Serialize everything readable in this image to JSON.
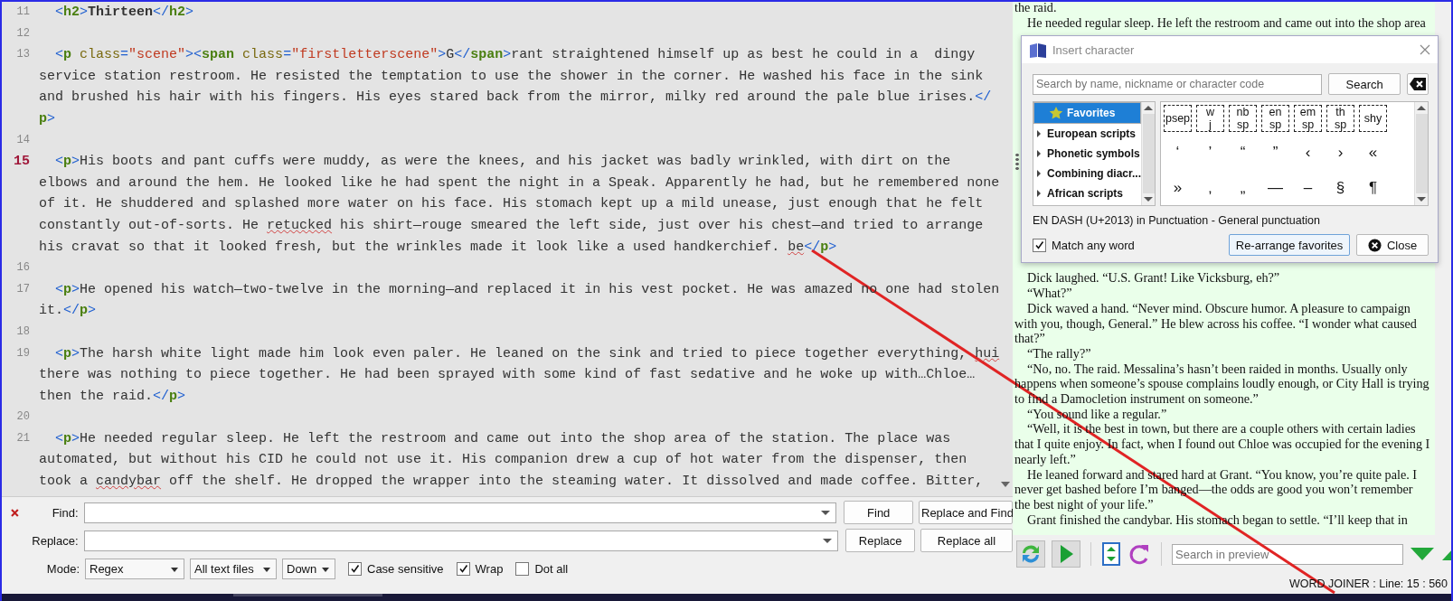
{
  "editor": {
    "lines": [
      {
        "number": "11",
        "current": false,
        "rows": [
          {
            "segments": [
              {
                "kind": "punct",
                "text": "<"
              },
              {
                "kind": "tag",
                "text": "h2"
              },
              {
                "kind": "punct",
                "text": ">"
              },
              {
                "kind": "bold",
                "text": "Thirteen"
              },
              {
                "kind": "punct",
                "text": "</"
              },
              {
                "kind": "tag",
                "text": "h2"
              },
              {
                "kind": "punct",
                "text": ">"
              }
            ]
          }
        ]
      },
      {
        "number": "12",
        "current": false
      },
      {
        "number": "13",
        "current": false,
        "rows": [
          {
            "segments": [
              {
                "kind": "punct",
                "text": "<"
              },
              {
                "kind": "tag",
                "text": "p"
              },
              {
                "kind": "attr",
                "text": " class"
              },
              {
                "kind": "punct",
                "text": "="
              },
              {
                "kind": "value",
                "text": "\"scene\""
              },
              {
                "kind": "punct",
                "text": "><"
              },
              {
                "kind": "tag",
                "text": "span"
              },
              {
                "kind": "attr",
                "text": " class"
              },
              {
                "kind": "punct",
                "text": "="
              },
              {
                "kind": "value",
                "text": "\"firstletterscene\""
              },
              {
                "kind": "punct",
                "text": ">"
              },
              {
                "kind": "text",
                "text": "G"
              },
              {
                "kind": "punct",
                "text": "</"
              },
              {
                "kind": "tag",
                "text": "span"
              },
              {
                "kind": "punct",
                "text": ">"
              },
              {
                "kind": "text",
                "text": "rant straightened himself up as best he could in a  dingy"
              }
            ]
          },
          {
            "segments": [
              {
                "kind": "text",
                "text": "service station restroom. He resisted the temptation to use the shower in the corner. He washed his face in the sink"
              }
            ]
          },
          {
            "segments": [
              {
                "kind": "text",
                "text": "and brushed his hair with his fingers. His eyes stared back from the mirror, milky red around the pale blue irises."
              },
              {
                "kind": "punct",
                "text": "</"
              }
            ]
          },
          {
            "segments": [
              {
                "kind": "tag",
                "text": "p"
              },
              {
                "kind": "punct",
                "text": ">"
              }
            ]
          }
        ]
      },
      {
        "number": "14",
        "current": false
      },
      {
        "number": "15",
        "current": true,
        "rows": [
          {
            "segments": [
              {
                "kind": "punct",
                "text": "<"
              },
              {
                "kind": "tag",
                "text": "p"
              },
              {
                "kind": "punct",
                "text": ">"
              },
              {
                "kind": "text",
                "text": "His boots and pant cuffs were muddy, as were the knees, and his jacket was badly wrinkled, with dirt on the"
              }
            ]
          },
          {
            "segments": [
              {
                "kind": "text",
                "text": "elbows and around the hem. He looked like he had spent the night in a Speak. Apparently he had, but he remembered none"
              }
            ]
          },
          {
            "segments": [
              {
                "kind": "text",
                "text": "of it. He shuddered and splashed more water on his face. His stomach kept up a mild unease, just enough that he felt"
              }
            ]
          },
          {
            "segments": [
              {
                "kind": "text",
                "text": "constantly out-of-sorts. He "
              },
              {
                "kind": "misspelled",
                "text": "retucked"
              },
              {
                "kind": "text",
                "text": " his shirt—rouge smeared the left side, just over his chest—and tried to arrange"
              }
            ]
          },
          {
            "segments": [
              {
                "kind": "text",
                "text": "his cravat so that it looked fresh, but the wrinkles made it look like a used handkerchief. "
              },
              {
                "kind": "misspelled",
                "text": "be"
              },
              {
                "kind": "punct",
                "text": "</"
              },
              {
                "kind": "tag",
                "text": "p"
              },
              {
                "kind": "punct",
                "text": ">"
              }
            ]
          }
        ]
      },
      {
        "number": "16",
        "current": false
      },
      {
        "number": "17",
        "current": false,
        "rows": [
          {
            "segments": [
              {
                "kind": "punct",
                "text": "<"
              },
              {
                "kind": "tag",
                "text": "p"
              },
              {
                "kind": "punct",
                "text": ">"
              },
              {
                "kind": "text",
                "text": "He opened his watch—two-twelve in the morning—and replaced it in his vest pocket. He was amazed no one had stolen"
              }
            ]
          },
          {
            "segments": [
              {
                "kind": "text",
                "text": "it."
              },
              {
                "kind": "punct",
                "text": "</"
              },
              {
                "kind": "tag",
                "text": "p"
              },
              {
                "kind": "punct",
                "text": ">"
              }
            ]
          }
        ]
      },
      {
        "number": "18",
        "current": false
      },
      {
        "number": "19",
        "current": false,
        "rows": [
          {
            "segments": [
              {
                "kind": "punct",
                "text": "<"
              },
              {
                "kind": "tag",
                "text": "p"
              },
              {
                "kind": "punct",
                "text": ">"
              },
              {
                "kind": "text",
                "text": "The harsh white light made him look even paler. He leaned on the sink and tried to piece together everything, "
              },
              {
                "kind": "misspelled",
                "text": "hui"
              }
            ]
          },
          {
            "segments": [
              {
                "kind": "text",
                "text": "there was nothing to piece together. He had been sprayed with some kind of fast sedative and he woke up with…Chloe…"
              }
            ]
          },
          {
            "segments": [
              {
                "kind": "text",
                "text": "then the raid."
              },
              {
                "kind": "punct",
                "text": "</"
              },
              {
                "kind": "tag",
                "text": "p"
              },
              {
                "kind": "punct",
                "text": ">"
              }
            ]
          }
        ]
      },
      {
        "number": "20",
        "current": false
      },
      {
        "number": "21",
        "current": false,
        "rows": [
          {
            "segments": [
              {
                "kind": "punct",
                "text": "<"
              },
              {
                "kind": "tag",
                "text": "p"
              },
              {
                "kind": "punct",
                "text": ">"
              },
              {
                "kind": "text",
                "text": "He needed regular sleep. He left the restroom and came out into the shop area of the station. The place was"
              }
            ]
          },
          {
            "segments": [
              {
                "kind": "text",
                "text": "automated, but without his CID he could not use it. His companion drew a cup of hot water from the dispenser, then"
              }
            ]
          },
          {
            "segments": [
              {
                "kind": "text",
                "text": "took a "
              },
              {
                "kind": "misspelled",
                "text": "candybar"
              },
              {
                "kind": "text",
                "text": " off the shelf. He dropped the wrapper into the steaming water. It dissolved and made coffee. Bitter,"
              }
            ]
          }
        ]
      }
    ]
  },
  "find_bar": {
    "find_label": "Find:",
    "replace_label": "Replace:",
    "mode_label": "Mode:",
    "find_button": "Find",
    "replace_and_find_button": "Replace and Find",
    "replace_button": "Replace",
    "replace_all_button": "Replace all",
    "mode": "Regex",
    "scope": "All text files",
    "direction": "Down",
    "options": [
      {
        "label": "Case sensitive",
        "checked": true
      },
      {
        "label": "Wrap",
        "checked": true
      },
      {
        "label": "Dot all",
        "checked": false
      }
    ]
  },
  "preview": {
    "continued_text": "the raid.",
    "first_paragraph": "He needed regular sleep. He left the restroom and came out into the shop area",
    "paragraphs": [
      "Dick laughed. “U.S. Grant! Like Vicksburg, eh?”",
      "“What?”",
      "Dick waved a hand. “Never mind. Obscure humor. A pleasure to campaign with you, though, General.” He blew across his coffee. “I wonder what caused that?”",
      "“The rally?”",
      "“No, no. The raid. Messalina’s hasn’t been raided in months. Usually only happens when someone’s spouse complains loudly enough, or City Hall is trying to find a Damocletion instrument on someone.”",
      "“You sound like a regular.”",
      "“Well, it is the best in town, but there are a couple others with certain ladies that I quite enjoy. In fact, when I found out Chloe was occupied for the evening I nearly left.”",
      "He leaned forward and stared hard at Grant. “You know, you’re quite pale. I never get bashed before I’m banged—the odds are good you won’t remember the best night of your life.”",
      "Grant finished the candybar. His stomach began to settle. “I’ll keep that in"
    ],
    "search_placeholder": "Search in preview"
  },
  "dialog": {
    "title": "Insert character",
    "search_placeholder": "Search by name, nickname or character code",
    "search_button": "Search",
    "categories": [
      {
        "label": "Favorites",
        "selected": true,
        "kind": "favorites"
      },
      {
        "label": "European scripts",
        "selected": false,
        "kind": "group"
      },
      {
        "label": "Phonetic symbols",
        "selected": false,
        "kind": "group"
      },
      {
        "label": "Combining diacr...",
        "selected": false,
        "kind": "group"
      },
      {
        "label": "African scripts",
        "selected": false,
        "kind": "group"
      }
    ],
    "characters": [
      {
        "kind": "special",
        "lines": [
          "psep"
        ]
      },
      {
        "kind": "special",
        "lines": [
          "w",
          "j"
        ]
      },
      {
        "kind": "special",
        "lines": [
          "nb",
          "sp"
        ]
      },
      {
        "kind": "special",
        "lines": [
          "en",
          "sp"
        ]
      },
      {
        "kind": "special",
        "lines": [
          "em",
          "sp"
        ]
      },
      {
        "kind": "special",
        "lines": [
          "th",
          "sp"
        ]
      },
      {
        "kind": "special",
        "lines": [
          "shy"
        ]
      },
      {
        "kind": "glyph",
        "lines": [
          "‘"
        ]
      },
      {
        "kind": "glyph",
        "lines": [
          "’"
        ]
      },
      {
        "kind": "glyph",
        "lines": [
          "“"
        ]
      },
      {
        "kind": "glyph",
        "lines": [
          "”"
        ]
      },
      {
        "kind": "glyph",
        "lines": [
          "‹"
        ]
      },
      {
        "kind": "glyph",
        "lines": [
          "›"
        ]
      },
      {
        "kind": "glyph",
        "lines": [
          "«"
        ]
      },
      {
        "kind": "glyph",
        "lines": [
          "»"
        ]
      },
      {
        "kind": "glyph",
        "lines": [
          "‚"
        ]
      },
      {
        "kind": "glyph",
        "lines": [
          "„"
        ]
      },
      {
        "kind": "glyph",
        "lines": [
          "—"
        ]
      },
      {
        "kind": "glyph",
        "lines": [
          "–"
        ]
      },
      {
        "kind": "glyph",
        "lines": [
          "§"
        ]
      },
      {
        "kind": "glyph",
        "lines": [
          "¶"
        ]
      }
    ],
    "info": "EN DASH (U+2013) in Punctuation - General punctuation",
    "match_any_word": {
      "label": "Match any word",
      "checked": true
    },
    "rearrange_button": "Re-arrange favorites",
    "close_button": "Close"
  },
  "status_bar": "WORD JOINER : Line: 15 : 560"
}
